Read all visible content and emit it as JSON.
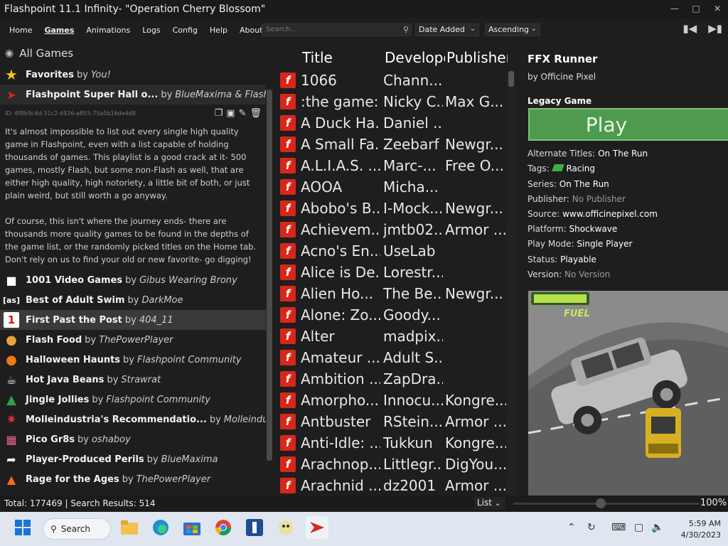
{
  "window": {
    "title": "Flashpoint 11.1 Infinity- \"Operation Cherry Blossom\""
  },
  "menu": {
    "items": [
      "Home",
      "Games",
      "Animations",
      "Logs",
      "Config",
      "Help",
      "About"
    ],
    "active": "Games"
  },
  "search": {
    "placeholder": "Search..."
  },
  "sort": {
    "field": "Date Added",
    "order": "Ascending"
  },
  "sidebar": {
    "all_games": "All Games",
    "playlists_top": [
      {
        "icon": "star-icon",
        "name": "Favorites",
        "author": "You!"
      },
      {
        "icon": "flashpoint-logo-icon",
        "name": "Flashpoint Super Hall o...",
        "author": "BlueMaxima & Flashpoi..."
      }
    ],
    "selected_id": "ID: 6f8b9c4d-31c2-4926-a855-75a5b16de4d8",
    "description": [
      "It's almost impossible to list out every single high quality game in Flashpoint, even with a list capable of holding thousands of games. This playlist is a good crack at it- 500 games, mostly Flash, but some non-Flash as well, that are either high quality, high notoriety, a little bit of both, or just plain weird, but still worth a go anyway.",
      "Of course, this isn't where the journey ends- there are thousands more quality games to be found in the depths of the game list, or the randomly picked titles on the Home tab. Don't rely on us to find your old or new favorite- go digging!"
    ],
    "by_word": "by",
    "playlists": [
      {
        "icon": "space-invader-icon",
        "name": "1001 Video Games",
        "author": "Gibus Wearing Brony"
      },
      {
        "icon": "adult-swim-icon",
        "name": "Best of Adult Swim",
        "author": "DarkMoe"
      },
      {
        "icon": "number-one-icon",
        "name": "First Past the Post",
        "author": "404_11"
      },
      {
        "icon": "burger-icon",
        "name": "Flash Food",
        "author": "ThePowerPlayer"
      },
      {
        "icon": "pumpkin-icon",
        "name": "Halloween Haunts",
        "author": "Flashpoint Community"
      },
      {
        "icon": "coffee-cup-icon",
        "name": "Hot Java Beans",
        "author": "Strawrat"
      },
      {
        "icon": "christmas-tree-icon",
        "name": "Jingle Jollies",
        "author": "Flashpoint Community"
      },
      {
        "icon": "molleindustria-icon",
        "name": "Molleindustria's Recommendatio...",
        "author": "Molleindust..."
      },
      {
        "icon": "pixel-grid-icon",
        "name": "Pico Gr8s",
        "author": "oshaboy"
      },
      {
        "icon": "share-arrow-icon",
        "name": "Player-Produced Perils",
        "author": "BlueMaxima"
      },
      {
        "icon": "fire-icon",
        "name": "Rage for the Ages",
        "author": "ThePowerPlayer"
      }
    ]
  },
  "grid": {
    "columns": [
      "Title",
      "Developer",
      "Publisher"
    ],
    "rows": [
      [
        "1066",
        "Chann...",
        ""
      ],
      [
        ":the game:",
        "Nicky C...",
        "Max G..."
      ],
      [
        "A Duck Ha...",
        "Daniel ...",
        ""
      ],
      [
        "A Small Fa...",
        "Zeebarf",
        "Newgr..."
      ],
      [
        "A.L.I.A.S. ...",
        "Marc-...",
        "Free O..."
      ],
      [
        "AOOA",
        "Micha...",
        ""
      ],
      [
        "Abobo's B...",
        "I-Mock...",
        "Newgr..."
      ],
      [
        "Achievem...",
        "jmtb02...",
        "Armor ..."
      ],
      [
        "Acno's En...",
        "UseLab",
        ""
      ],
      [
        "Alice is De...",
        "Lorestr...",
        ""
      ],
      [
        "Alien Ho...",
        "The Be...",
        "Newgr..."
      ],
      [
        "Alone: Zo...",
        "Goody...",
        ""
      ],
      [
        "Alter",
        "madpix...",
        ""
      ],
      [
        "Amateur ...",
        "Adult S...",
        ""
      ],
      [
        "Ambition ...",
        "ZapDra...",
        ""
      ],
      [
        "Amorpho...",
        "Innocu...",
        "Kongre..."
      ],
      [
        "Antbuster",
        "RStein....",
        "Armor ..."
      ],
      [
        "Anti-Idle: ...",
        "Tukkun",
        "Kongre..."
      ],
      [
        "Arachnop...",
        "Littlegr...",
        "DigYou..."
      ],
      [
        "Arachnid ...",
        "dz2001",
        "Armor ..."
      ]
    ]
  },
  "details": {
    "title": "FFX Runner",
    "developer_line": "by Officine Pixel",
    "library": "Legacy Game",
    "play_label": "Play",
    "alt_titles_label": "Alternate Titles:",
    "alt_titles": "On The Run",
    "tags_label": "Tags:",
    "tag": "Racing",
    "series_label": "Series:",
    "series": "On The Run",
    "publisher_label": "Publisher:",
    "publisher": "No Publisher",
    "source_label": "Source:",
    "source": "www.officinepixel.com",
    "platform_label": "Platform:",
    "platform": "Shockwave",
    "playmode_label": "Play Mode:",
    "playmode": "Single Player",
    "status_label": "Status:",
    "status": "Playable",
    "version_label": "Version:",
    "version": "No Version",
    "screenshot_fuel_label": "FUEL"
  },
  "statusbar": {
    "text": "Total: 177469  |  Search Results: 514",
    "view_mode": "List",
    "zoom": "100%",
    "zoom_level_fraction": 0.47
  },
  "taskbar": {
    "search_label": "Search",
    "time": "5:59 AM",
    "date": "4/30/2023"
  },
  "colors": {
    "flash_icon": "#d8261c",
    "play_button": "#4e9a4e",
    "tag_icon": "#3fae49",
    "background": "#1e1e1e"
  }
}
